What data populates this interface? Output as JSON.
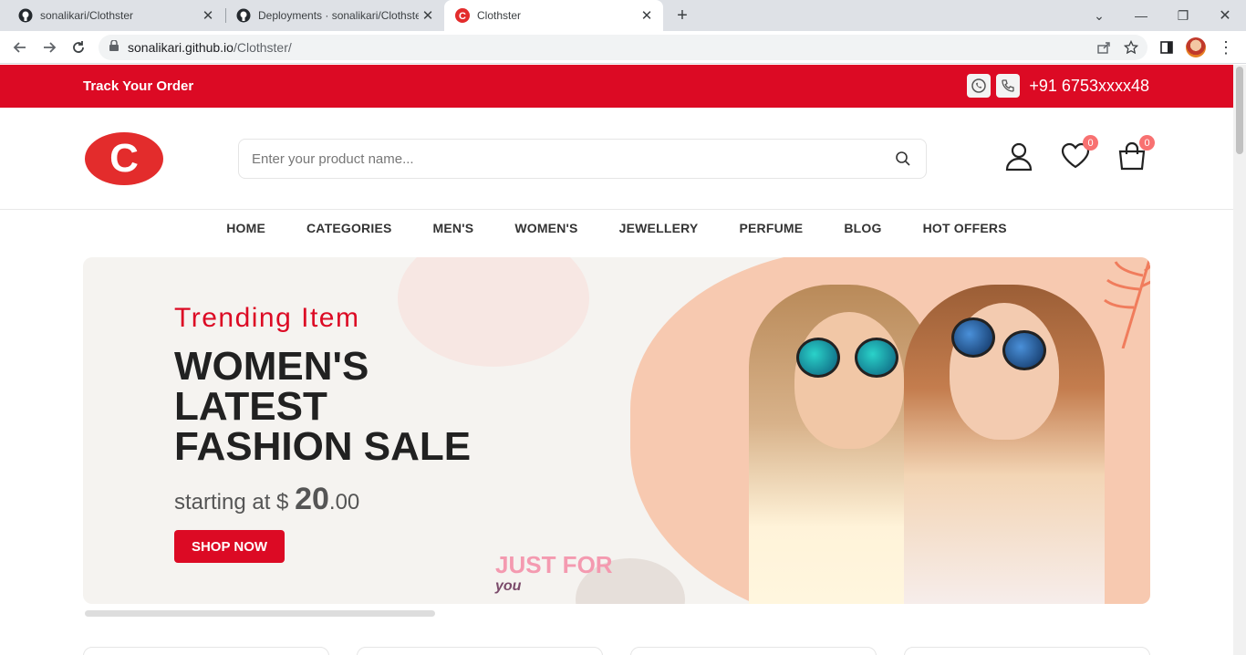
{
  "browser": {
    "tabs": [
      {
        "title": "sonalikari/Clothster",
        "active": false
      },
      {
        "title": "Deployments · sonalikari/Clothster",
        "active": false
      },
      {
        "title": "Clothster",
        "active": true
      }
    ],
    "url_host": "sonalikari.github.io",
    "url_path": "/Clothster/"
  },
  "topbar": {
    "track_label": "Track Your Order",
    "phone": "+91 6753xxxx48"
  },
  "header": {
    "logo_letter": "C",
    "search_placeholder": "Enter your product name...",
    "wishlist_count": "0",
    "cart_count": "0"
  },
  "nav": [
    "HOME",
    "CATEGORIES",
    "MEN'S",
    "WOMEN'S",
    "JEWELLERY",
    "PERFUME",
    "BLOG",
    "HOT OFFERS"
  ],
  "banner": {
    "subtitle": "Trending Item",
    "headline_lines": [
      "WOMEN'S",
      "LATEST",
      "FASHION SALE"
    ],
    "price_prefix": "starting at $ ",
    "price_whole": "20",
    "price_cents": ".00",
    "cta": "SHOP NOW",
    "tag": "JUST FOR",
    "tag2": "you"
  },
  "colors": {
    "brand_red": "#dc0a24",
    "logo_red": "#e32c2c",
    "badge": "#f87171"
  }
}
